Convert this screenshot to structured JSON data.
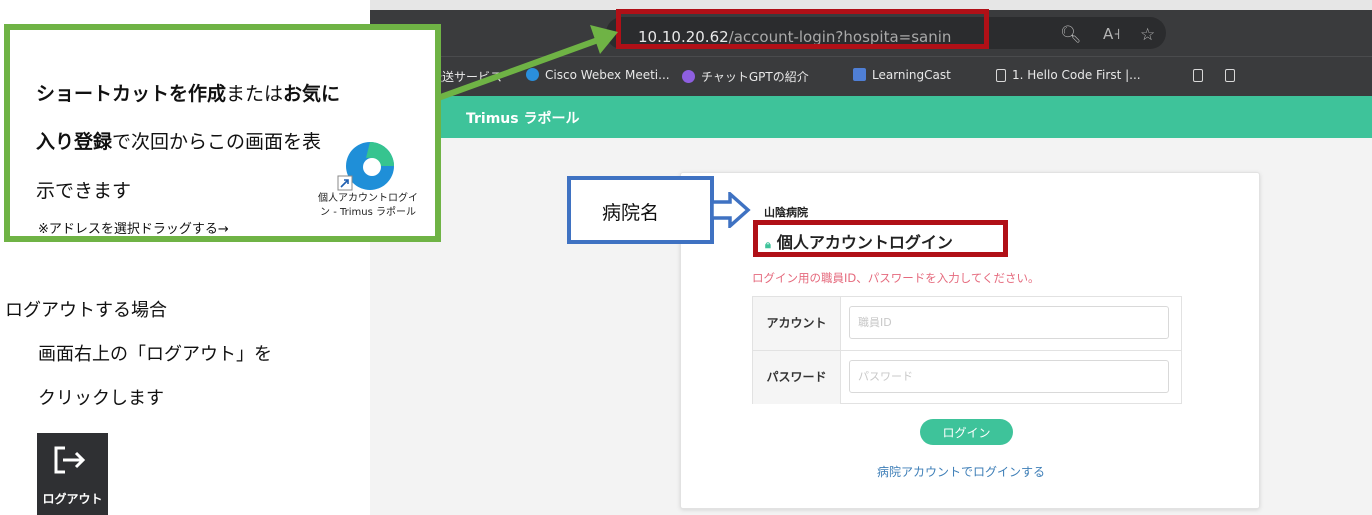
{
  "browser": {
    "url_host": "10.10.20.62",
    "url_path": "/account-login?hospita=sanin",
    "bookmarks": [
      "ル転送サービス",
      "Cisco Webex Meeti...",
      "チャットGPTの紹介",
      "LearningCast",
      "1. Hello Code First |..."
    ]
  },
  "app": {
    "title": "Trimus ラポール",
    "accent_color": "#3ec39a"
  },
  "login": {
    "hospital_name": "山陰病院",
    "heading": "個人アカウントログイン",
    "instruction": "ログイン用の職員ID、パスワードを入力してください。",
    "account_label": "アカウント",
    "account_placeholder": "職員ID",
    "password_label": "パスワード",
    "password_placeholder": "パスワード",
    "login_button": "ログイン",
    "hospital_login_link": "病院アカウントでログインする"
  },
  "annotations": {
    "callout": {
      "line1_bold_a": "ショートカットを作成",
      "line1_plain": "または",
      "line1_bold_b": "お気に",
      "line2_bold": "入り登録",
      "line2_plain": "で次回からこの画面を表",
      "line3": "示できます",
      "note": "※アドレスを選択ドラッグする→",
      "shortcut_caption_1": "個人アカウントログイ",
      "shortcut_caption_2": "ン - Trimus ラポール",
      "border_color": "#6fb345"
    },
    "hospital_label": "病院名",
    "logout": {
      "heading": "ログアウトする場合",
      "line2": "画面右上の「ログアウト」を",
      "line3": "クリックします",
      "button_caption": "ログアウト"
    },
    "highlight_color": "#b01017"
  }
}
